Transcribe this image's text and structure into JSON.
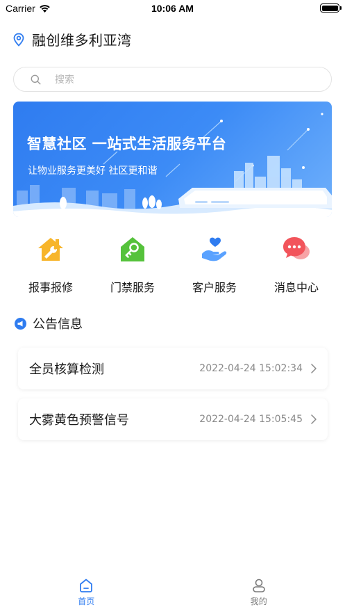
{
  "status_bar": {
    "carrier": "Carrier",
    "time": "10:06 AM"
  },
  "header": {
    "title": "融创维多利亚湾",
    "icon": "location-pin-icon"
  },
  "search": {
    "placeholder": "搜索"
  },
  "banner": {
    "headline": "智慧社区 一站式生活服务平台",
    "subtitle": "让物业服务更美好 社区更和谐"
  },
  "actions": [
    {
      "label": "报事报修",
      "icon": "repair-house-icon",
      "color": "#f7b52b"
    },
    {
      "label": "门禁服务",
      "icon": "door-key-icon",
      "color": "#55c23b"
    },
    {
      "label": "客户服务",
      "icon": "heart-hand-icon",
      "color": "#2f7cf0"
    },
    {
      "label": "消息中心",
      "icon": "chat-bubble-icon",
      "color": "#f2545b"
    }
  ],
  "notices_section": {
    "title": "公告信息",
    "icon": "megaphone-icon"
  },
  "notices": [
    {
      "title": "全员核算检测",
      "time": "2022-04-24 15:02:34"
    },
    {
      "title": "大雾黄色预警信号",
      "time": "2022-04-24 15:05:45"
    }
  ],
  "tabbar": {
    "home": {
      "label": "首页",
      "icon": "home-icon"
    },
    "mine": {
      "label": "我的",
      "icon": "user-icon"
    }
  },
  "colors": {
    "accent": "#2f7cf0",
    "text": "#1a1a1a",
    "muted": "#8a8a8a"
  }
}
